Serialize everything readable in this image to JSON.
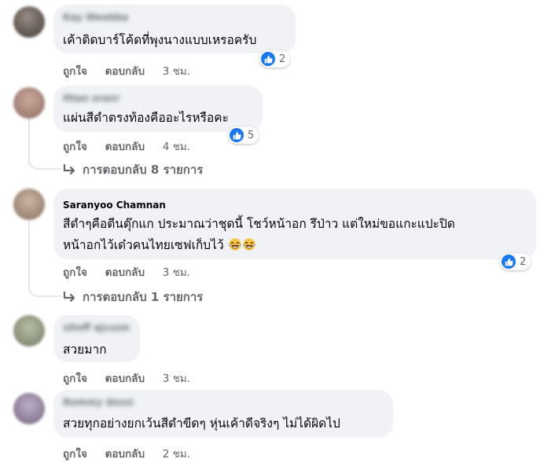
{
  "colors": {
    "bubble_bg": "#f0f2f5",
    "meta_text": "#65676b",
    "like_blue": "#1877f2",
    "thread_line": "#e4e6eb"
  },
  "icons": {
    "like": "like-thumbs-up-icon",
    "reply_arrow": "reply-arrow-icon",
    "emoji": "tears-of-joy-emoji-icon"
  },
  "comments": [
    {
      "author": "Kay Weebba",
      "author_blurred": true,
      "text": "เค้าติดบาร์โค้ดที่พุงนางแบบเหรอครับ",
      "reactions": "2",
      "actions": {
        "like": "ถูกใจ",
        "reply": "ตอบกลับ",
        "time": "3 ชม."
      }
    },
    {
      "author": "Ittan sranr",
      "author_blurred": true,
      "text": "แผ่นสีดำตรงท้องคืออะไรหรือคะ",
      "reactions": "5",
      "actions": {
        "like": "ถูกใจ",
        "reply": "ตอบกลับ",
        "time": "4 ชม."
      },
      "replies": "การตอบกลับ 8 รายการ"
    },
    {
      "author": "Saranyoo Chamnan",
      "author_blurred": false,
      "text_line1": "สีดำๆคือตีนตุ๊กแก ประมาณว่าชุดนี้ โชว์หน้าอก รึป่าว แต่ใหม่ขอแกะแปะปิด",
      "text_line2": "หน้าอกไว้เด๋วคนไทยเซฟเก็บไว้",
      "reactions": "2",
      "actions": {
        "like": "ถูกใจ",
        "reply": "ตอบกลับ",
        "time": "3 ชม."
      },
      "replies": "การตอบกลับ 1 รายการ"
    },
    {
      "author": "sitoff ajcszm",
      "author_blurred": true,
      "text": "สวยมาก",
      "actions": {
        "like": "ถูกใจ",
        "reply": "ตอบกลับ",
        "time": "3 ชม."
      }
    },
    {
      "author": "Rommy dossi",
      "author_blurred": true,
      "text": "สวยทุกอย่างยกเว้นสีดำขีดๆ หุ่นเค้าดีจริงๆ ไม่ได้ผิดไป",
      "actions": {
        "like": "ถูกใจ",
        "reply": "ตอบกลับ",
        "time": "2 ชม."
      }
    }
  ]
}
